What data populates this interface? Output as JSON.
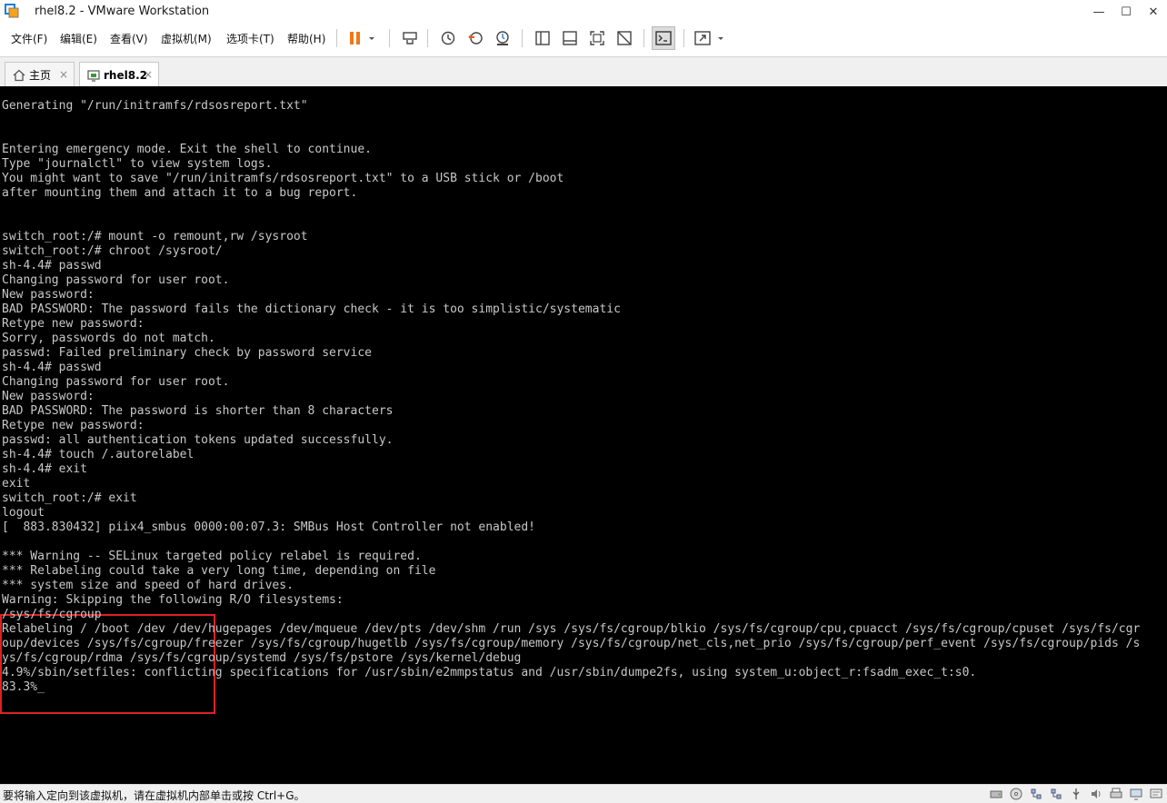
{
  "window": {
    "title": "rhel8.2 - VMware Workstation",
    "minimize_label": "—",
    "maximize_label": "☐",
    "close_label": "✕"
  },
  "menu": {
    "file": "文件(F)",
    "edit": "编辑(E)",
    "view": "查看(V)",
    "vm": "虚拟机(M)",
    "tabs": "选项卡(T)",
    "help": "帮助(H)"
  },
  "tabs": [
    {
      "label": "主页",
      "close": "×"
    },
    {
      "label": "rhel8.2",
      "close": "×"
    }
  ],
  "console": {
    "lines": [
      "Generating \"/run/initramfs/rdsosreport.txt\"",
      "",
      "",
      "Entering emergency mode. Exit the shell to continue.",
      "Type \"journalctl\" to view system logs.",
      "You might want to save \"/run/initramfs/rdsosreport.txt\" to a USB stick or /boot",
      "after mounting them and attach it to a bug report.",
      "",
      "",
      "switch_root:/# mount -o remount,rw /sysroot",
      "switch_root:/# chroot /sysroot/",
      "sh-4.4# passwd",
      "Changing password for user root.",
      "New password:",
      "BAD PASSWORD: The password fails the dictionary check - it is too simplistic/systematic",
      "Retype new password:",
      "Sorry, passwords do not match.",
      "passwd: Failed preliminary check by password service",
      "sh-4.4# passwd",
      "Changing password for user root.",
      "New password:",
      "BAD PASSWORD: The password is shorter than 8 characters",
      "Retype new password:",
      "passwd: all authentication tokens updated successfully.",
      "sh-4.4# touch /.autorelabel",
      "sh-4.4# exit",
      "exit",
      "switch_root:/# exit",
      "logout",
      "[  883.830432] piix4_smbus 0000:00:07.3: SMBus Host Controller not enabled!",
      "",
      "*** Warning -- SELinux targeted policy relabel is required.",
      "*** Relabeling could take a very long time, depending on file",
      "*** system size and speed of hard drives.",
      "Warning: Skipping the following R/O filesystems:",
      "/sys/fs/cgroup",
      "Relabeling / /boot /dev /dev/hugepages /dev/mqueue /dev/pts /dev/shm /run /sys /sys/fs/cgroup/blkio /sys/fs/cgroup/cpu,cpuacct /sys/fs/cgroup/cpuset /sys/fs/cgr",
      "oup/devices /sys/fs/cgroup/freezer /sys/fs/cgroup/hugetlb /sys/fs/cgroup/memory /sys/fs/cgroup/net_cls,net_prio /sys/fs/cgroup/perf_event /sys/fs/cgroup/pids /s",
      "ys/fs/cgroup/rdma /sys/fs/cgroup/systemd /sys/fs/pstore /sys/kernel/debug",
      "4.9%/sbin/setfiles: conflicting specifications for /usr/sbin/e2mmpstatus and /usr/sbin/dumpe2fs, using system_u:object_r:fsadm_exec_t:s0.",
      "83.3%_"
    ]
  },
  "statusbar": {
    "message": "要将输入定向到该虚拟机，请在虚拟机内部单击或按 Ctrl+G。"
  }
}
